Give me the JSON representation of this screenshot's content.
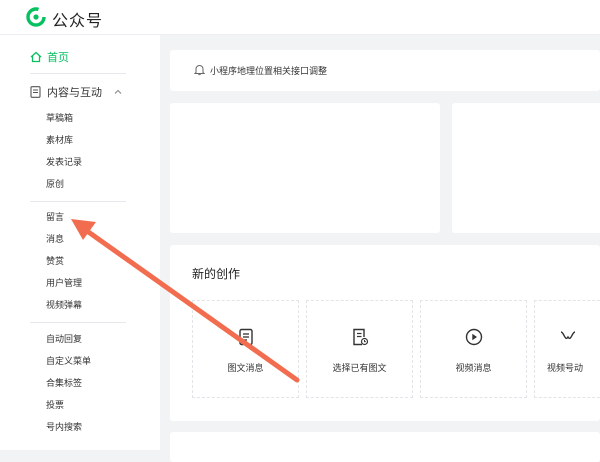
{
  "app": {
    "title": "公众号"
  },
  "sidebar": {
    "home": "首页",
    "group": "内容与互动",
    "items": [
      "草稿箱",
      "素材库",
      "发表记录",
      "原创",
      "留言",
      "消息",
      "赞赏",
      "用户管理",
      "视频弹幕",
      "自动回复",
      "自定义菜单",
      "合集标签",
      "投票",
      "号内搜索"
    ]
  },
  "notice": {
    "text": "小程序地理位置相关接口调整"
  },
  "create": {
    "title": "新的创作",
    "tiles": [
      "图文消息",
      "选择已有图文",
      "视频消息",
      "视频号动"
    ]
  },
  "colors": {
    "brand": "#07c160",
    "annotation_arrow": "#f26d4f"
  }
}
